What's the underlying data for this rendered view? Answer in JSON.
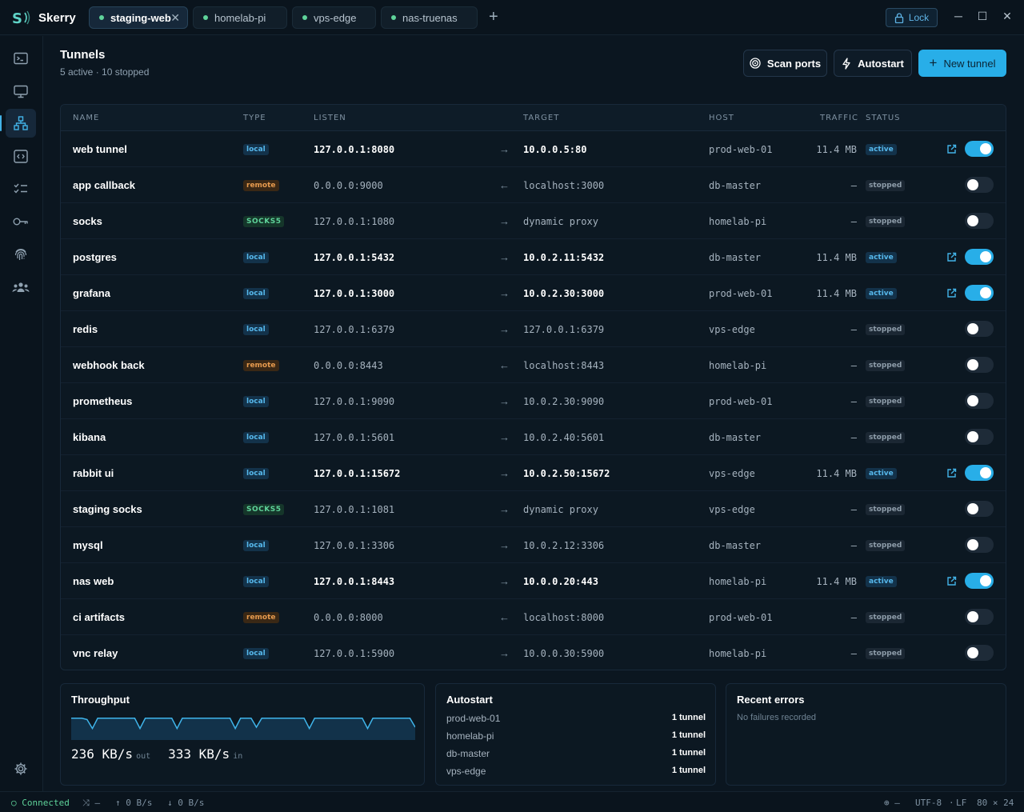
{
  "app": {
    "name": "Skerry",
    "logo_text": "S"
  },
  "tabs": [
    {
      "label": "staging-web",
      "active": true
    },
    {
      "label": "homelab-pi",
      "active": false
    },
    {
      "label": "vps-edge",
      "active": false
    },
    {
      "label": "nas-truenas",
      "active": false
    }
  ],
  "titlebar": {
    "lock_label": "Lock"
  },
  "sidebar": {
    "items": [
      "terminal",
      "monitor",
      "tunnels",
      "code",
      "checklist",
      "keys",
      "fingerprint",
      "team"
    ],
    "active": "tunnels"
  },
  "header": {
    "title": "Tunnels",
    "subtitle": "5 active · 10 stopped",
    "scan_label": "Scan ports",
    "autostart_label": "Autostart",
    "new_label": "New tunnel"
  },
  "columns": {
    "name": "NAME",
    "type": "TYPE",
    "listen": "LISTEN",
    "target": "TARGET",
    "host": "HOST",
    "traffic": "TRAFFIC",
    "status": "STATUS"
  },
  "tunnels": [
    {
      "name": "web tunnel",
      "type": "local",
      "listen": "127.0.0.1:8080",
      "target": "10.0.0.5:80",
      "host": "prod-web-01",
      "traffic": "11.4 MB",
      "status": "active"
    },
    {
      "name": "app callback",
      "type": "remote",
      "listen": "0.0.0.0:9000",
      "target": "localhost:3000",
      "host": "db-master",
      "traffic": "—",
      "status": "stopped"
    },
    {
      "name": "socks",
      "type": "SOCKS5",
      "listen": "127.0.0.1:1080",
      "target": "dynamic proxy",
      "host": "homelab-pi",
      "traffic": "—",
      "status": "stopped"
    },
    {
      "name": "postgres",
      "type": "local",
      "listen": "127.0.0.1:5432",
      "target": "10.0.2.11:5432",
      "host": "db-master",
      "traffic": "11.4 MB",
      "status": "active"
    },
    {
      "name": "grafana",
      "type": "local",
      "listen": "127.0.0.1:3000",
      "target": "10.0.2.30:3000",
      "host": "prod-web-01",
      "traffic": "11.4 MB",
      "status": "active"
    },
    {
      "name": "redis",
      "type": "local",
      "listen": "127.0.0.1:6379",
      "target": "127.0.0.1:6379",
      "host": "vps-edge",
      "traffic": "—",
      "status": "stopped"
    },
    {
      "name": "webhook back",
      "type": "remote",
      "listen": "0.0.0.0:8443",
      "target": "localhost:8443",
      "host": "homelab-pi",
      "traffic": "—",
      "status": "stopped"
    },
    {
      "name": "prometheus",
      "type": "local",
      "listen": "127.0.0.1:9090",
      "target": "10.0.2.30:9090",
      "host": "prod-web-01",
      "traffic": "—",
      "status": "stopped"
    },
    {
      "name": "kibana",
      "type": "local",
      "listen": "127.0.0.1:5601",
      "target": "10.0.2.40:5601",
      "host": "db-master",
      "traffic": "—",
      "status": "stopped"
    },
    {
      "name": "rabbit ui",
      "type": "local",
      "listen": "127.0.0.1:15672",
      "target": "10.0.2.50:15672",
      "host": "vps-edge",
      "traffic": "11.4 MB",
      "status": "active"
    },
    {
      "name": "staging socks",
      "type": "SOCKS5",
      "listen": "127.0.0.1:1081",
      "target": "dynamic proxy",
      "host": "vps-edge",
      "traffic": "—",
      "status": "stopped"
    },
    {
      "name": "mysql",
      "type": "local",
      "listen": "127.0.0.1:3306",
      "target": "10.0.2.12:3306",
      "host": "db-master",
      "traffic": "—",
      "status": "stopped"
    },
    {
      "name": "nas web",
      "type": "local",
      "listen": "127.0.0.1:8443",
      "target": "10.0.0.20:443",
      "host": "homelab-pi",
      "traffic": "11.4 MB",
      "status": "active"
    },
    {
      "name": "ci artifacts",
      "type": "remote",
      "listen": "0.0.0.0:8000",
      "target": "localhost:8000",
      "host": "prod-web-01",
      "traffic": "—",
      "status": "stopped"
    },
    {
      "name": "vnc relay",
      "type": "local",
      "listen": "127.0.0.1:5900",
      "target": "10.0.0.30:5900",
      "host": "homelab-pi",
      "traffic": "—",
      "status": "stopped"
    }
  ],
  "throughput": {
    "title": "Throughput",
    "out_value": "236 KB/s",
    "out_label": "out",
    "in_value": "333 KB/s",
    "in_label": "in",
    "spark": [
      0.85,
      0.85,
      0.85,
      0.8,
      0.45,
      0.85,
      0.85,
      0.85,
      0.85,
      0.85,
      0.85,
      0.85,
      0.85,
      0.45,
      0.85,
      0.85,
      0.85,
      0.85,
      0.85,
      0.85,
      0.45,
      0.85,
      0.85,
      0.85,
      0.85,
      0.85,
      0.85,
      0.85,
      0.85,
      0.85,
      0.85,
      0.45,
      0.85,
      0.85,
      0.85,
      0.5,
      0.85,
      0.85,
      0.85,
      0.85,
      0.85,
      0.85,
      0.85,
      0.85,
      0.85,
      0.45,
      0.85,
      0.85,
      0.85,
      0.85,
      0.85,
      0.85,
      0.85,
      0.85,
      0.85,
      0.85,
      0.45,
      0.85,
      0.85,
      0.85,
      0.85,
      0.85,
      0.85,
      0.85,
      0.85,
      0.5
    ],
    "color": "#3fb4ea"
  },
  "autostart": {
    "title": "Autostart",
    "rows": [
      {
        "host": "prod-web-01",
        "count": "1 tunnel"
      },
      {
        "host": "homelab-pi",
        "count": "1 tunnel"
      },
      {
        "host": "db-master",
        "count": "1 tunnel"
      },
      {
        "host": "vps-edge",
        "count": "1 tunnel"
      }
    ]
  },
  "errors": {
    "title": "Recent errors",
    "empty": "No failures recorded"
  },
  "statusbar": {
    "connected": "Connected",
    "branch": "—",
    "up": "0 B/s",
    "down": "0 B/s",
    "globe_val": "—",
    "encoding": "UTF-8",
    "eol": "LF",
    "size": "80 × 24"
  }
}
